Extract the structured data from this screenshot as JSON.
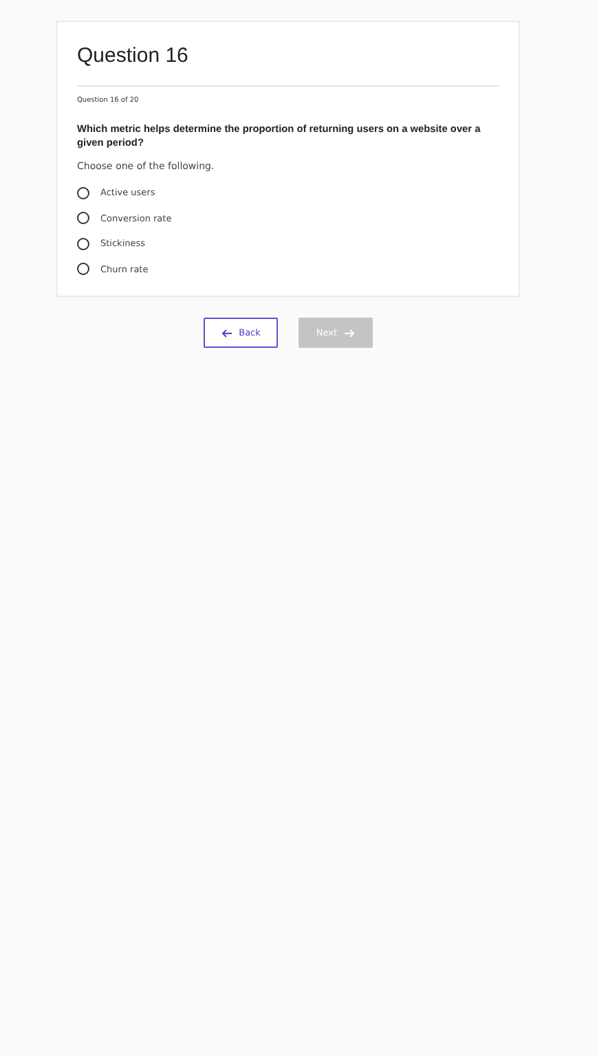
{
  "title": "Question 16",
  "progress": "Question 16 of 20",
  "question": "Which metric helps determine the proportion of returning users on a website over a given period?",
  "instruction": "Choose one of the following.",
  "options": [
    {
      "label": "Active users",
      "selected": false
    },
    {
      "label": "Conversion rate",
      "selected": false
    },
    {
      "label": "Stickiness",
      "selected": false
    },
    {
      "label": "Churn rate",
      "selected": false
    }
  ],
  "buttons": [
    {
      "kind": "back",
      "label": "Back",
      "disabled": false
    },
    {
      "kind": "next",
      "label": "Next",
      "disabled": true
    }
  ]
}
